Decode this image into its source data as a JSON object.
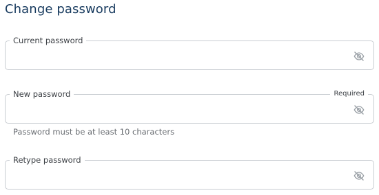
{
  "page": {
    "title": "Change password"
  },
  "fields": {
    "current": {
      "label": "Current password",
      "value": "",
      "toggle_icon": "eye-off-icon"
    },
    "new": {
      "label": "New password",
      "required_label": "Required",
      "value": "",
      "helper_text": "Password must be at least 10 characters",
      "toggle_icon": "eye-off-icon"
    },
    "retype": {
      "label": "Retype password",
      "value": "",
      "toggle_icon": "eye-off-icon"
    }
  },
  "colors": {
    "title": "#173a5e",
    "border": "#c8ccd1",
    "label": "#3b3f44",
    "helper": "#6a6e73",
    "icon": "#9aa0a6"
  }
}
